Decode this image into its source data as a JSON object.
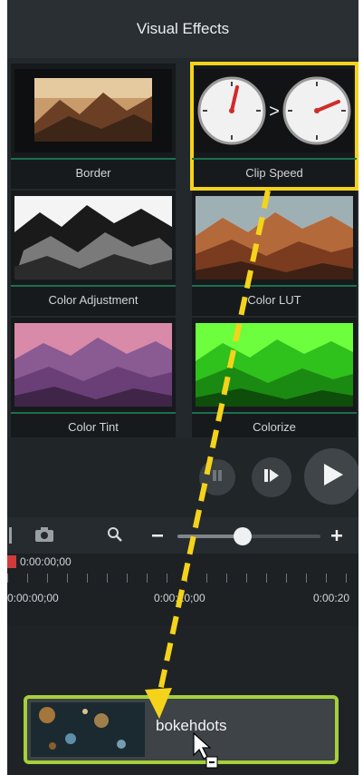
{
  "panel": {
    "title": "Visual Effects",
    "effects": [
      {
        "label": "Border"
      },
      {
        "label": "Clip Speed",
        "selected": true
      },
      {
        "label": "Color Adjustment"
      },
      {
        "label": "Color LUT"
      },
      {
        "label": "Color Tint"
      },
      {
        "label": "Colorize"
      }
    ]
  },
  "timeline": {
    "playhead_time": "0:00:00;00",
    "ruler_times": [
      "0:00:00;00",
      "0:00:10;00",
      "0:00:20"
    ],
    "clip": {
      "name": "bokehdots"
    }
  },
  "colors": {
    "highlight": "#f5d31b",
    "arrow": "#f5d31b",
    "clip_border": "#a6cf3a",
    "panel_bg": "#23282c"
  },
  "icons": [
    "pause-icon",
    "step-forward-icon",
    "play-icon",
    "camera-icon",
    "zoom-icon",
    "minus-icon",
    "plus-icon",
    "cursor-icon"
  ]
}
